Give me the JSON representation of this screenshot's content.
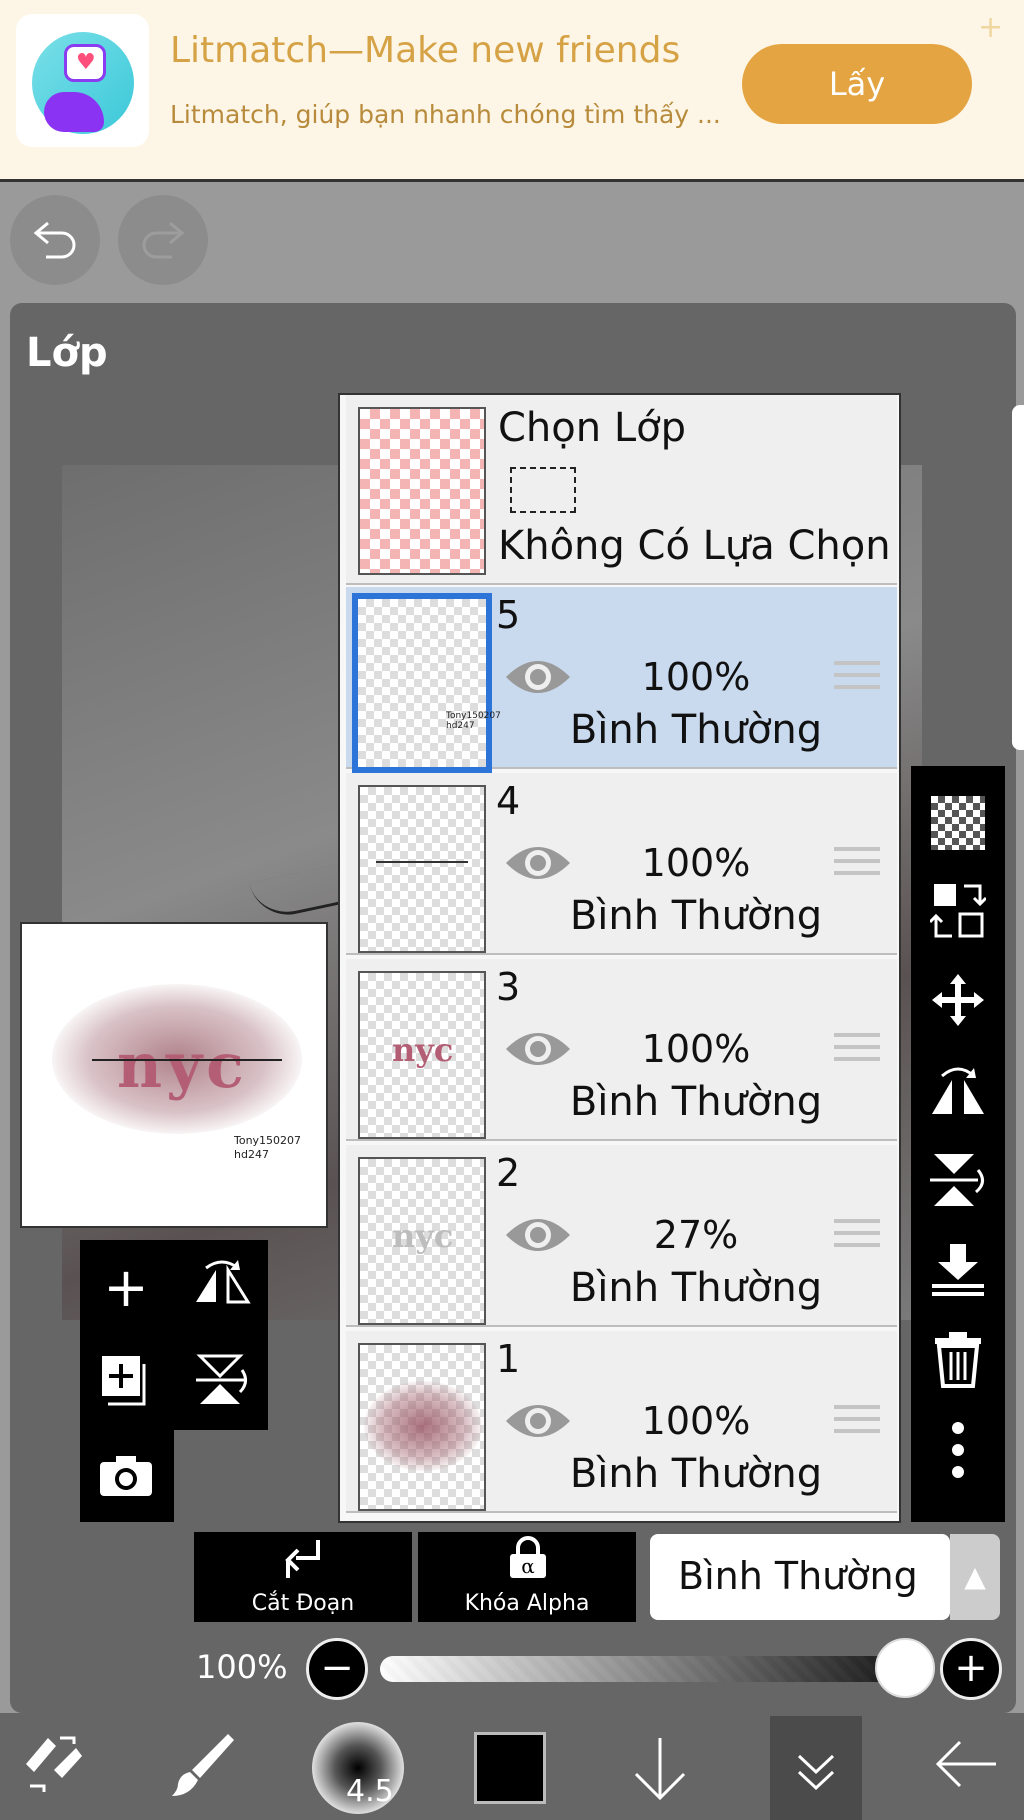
{
  "ad": {
    "title": "Litmatch—Make new friends",
    "subtitle": "Litmatch, giúp bạn nhanh chóng tìm thấy ...",
    "button": "Lấy"
  },
  "panel": {
    "title": "Lớp"
  },
  "selection_layer": {
    "title": "Chọn Lớp",
    "status": "Không Có Lựa Chọn"
  },
  "layers": [
    {
      "number": "5",
      "opacity": "100%",
      "mode": "Bình Thường",
      "selected": true
    },
    {
      "number": "4",
      "opacity": "100%",
      "mode": "Bình Thường",
      "selected": false
    },
    {
      "number": "3",
      "opacity": "100%",
      "mode": "Bình Thường",
      "selected": false
    },
    {
      "number": "2",
      "opacity": "27%",
      "mode": "Bình Thường",
      "selected": false
    },
    {
      "number": "1",
      "opacity": "100%",
      "mode": "Bình Thường",
      "selected": false
    }
  ],
  "preview": {
    "text": "nyc",
    "signature": "Tony150207 hd247"
  },
  "actions": {
    "clip": "Cắt Đoạn",
    "alpha_lock": "Khóa Alpha",
    "blend_mode": "Bình Thường"
  },
  "opacity": {
    "label": "100%",
    "value": 1.0
  },
  "brush": {
    "size": "4.5"
  },
  "colors": {
    "selected_layer_bg": "#c9d9ee",
    "selected_border": "#2d74d8",
    "ad_accent": "#e3a441",
    "current_color": "#000000"
  },
  "icons": {
    "right_toolbar": [
      "checker-icon",
      "transfer-icon",
      "move-icon",
      "flip-horizontal-icon",
      "flip-vertical-icon",
      "merge-down-icon",
      "trash-icon",
      "more-icon"
    ],
    "left_toolbar": [
      "add-layer-icon",
      "flip-horizontal-icon",
      "add-copy-icon",
      "flip-vertical-icon",
      "camera-icon"
    ],
    "bottom_bar": [
      "transform-icon",
      "brush-icon",
      "brush-size-icon",
      "color-swatch-icon",
      "arrow-down-icon",
      "chevron-down-icon",
      "back-arrow-icon"
    ]
  }
}
